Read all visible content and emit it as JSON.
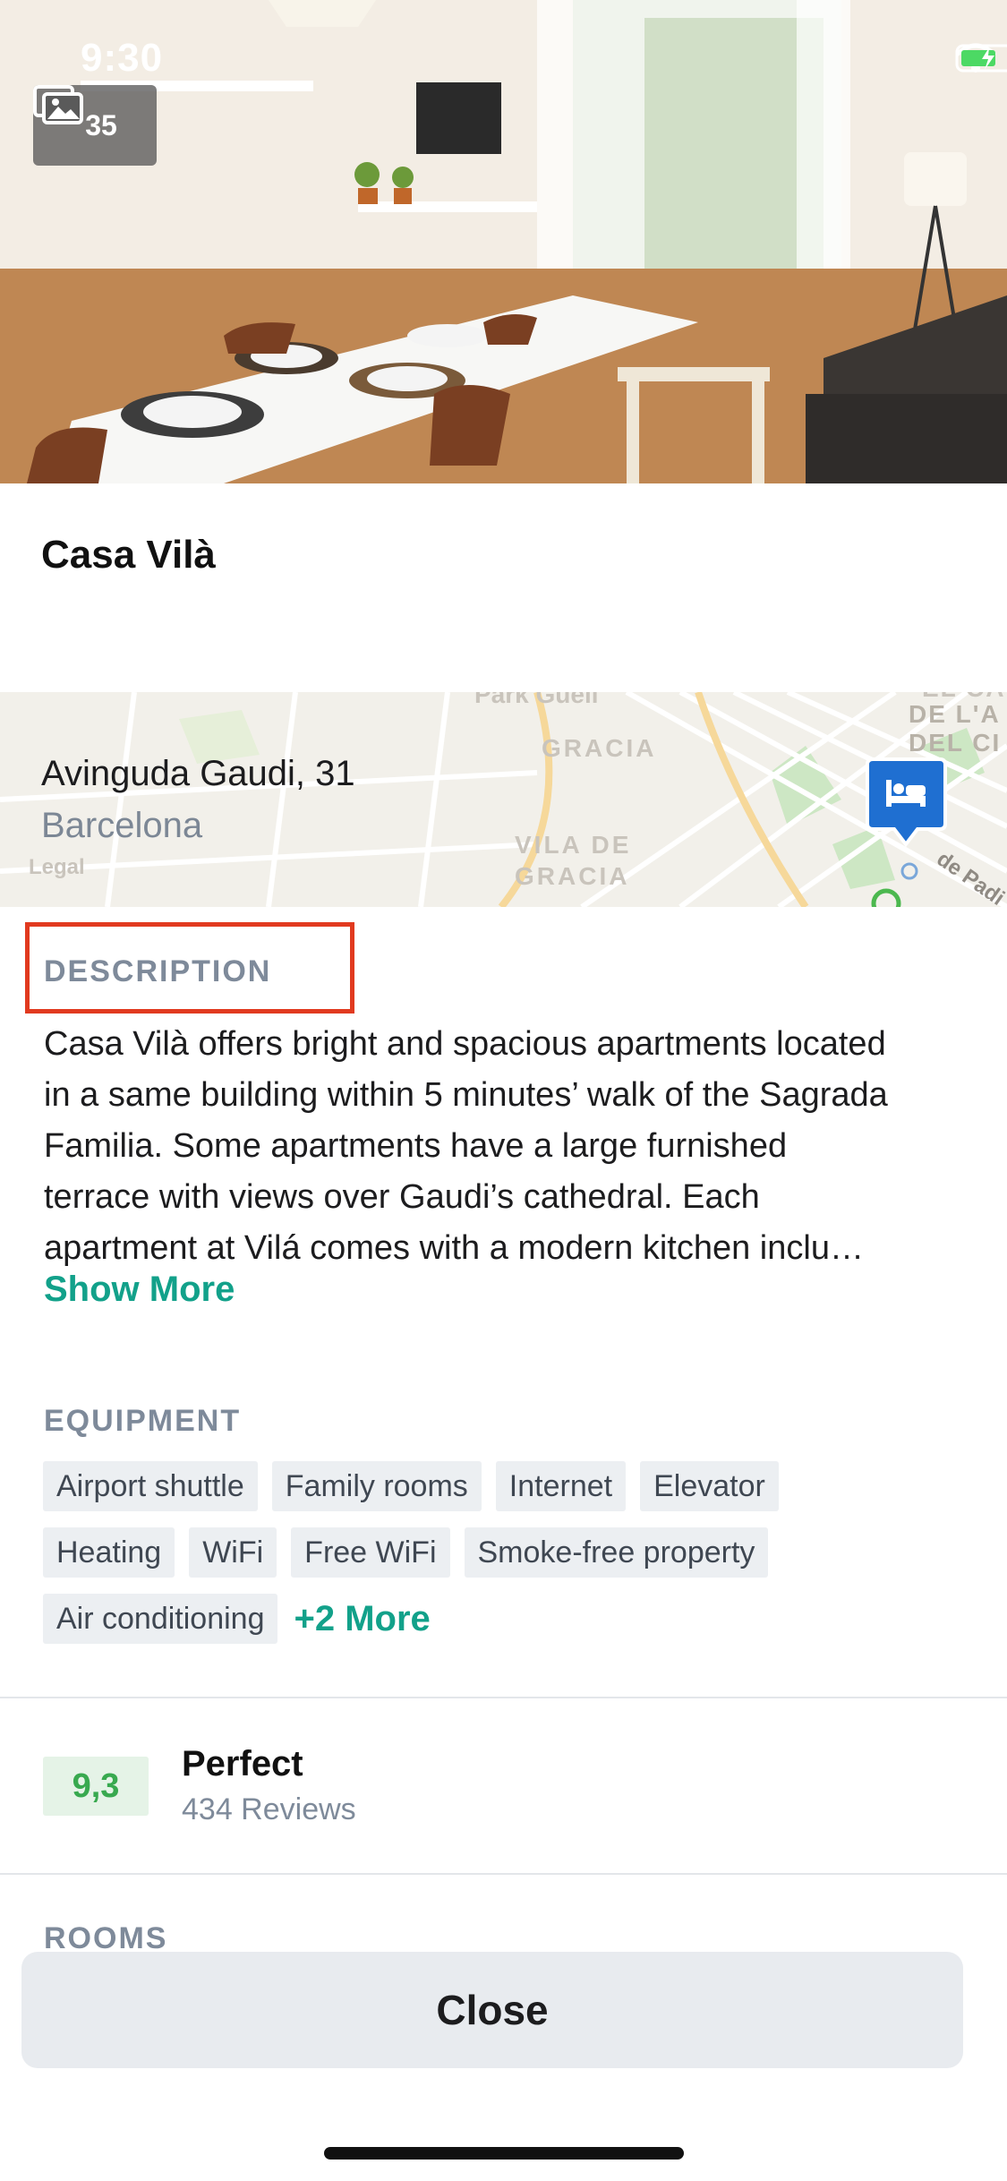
{
  "status_bar": {
    "time": "9:30"
  },
  "gallery": {
    "count": "35"
  },
  "hotel": {
    "name": "Casa Vilà",
    "address_line": "Avinguda Gaudi, 31",
    "city": "Barcelona"
  },
  "map": {
    "labels": [
      "Park Güell",
      "GRACIA",
      "VILA DE",
      "GRACIA",
      "EL CA",
      "DE L'A",
      "DEL CI",
      "de Padi",
      "Legal"
    ]
  },
  "description": {
    "heading": "DESCRIPTION",
    "lines": [
      "Casa Vilà offers bright and spacious apartments located",
      "in a same building within 5 minutes’ walk of the Sagrada",
      "Familia. Some apartments have a large furnished",
      "terrace with views over Gaudi’s cathedral. Each",
      "apartment at Vilá comes with a modern kitchen inclu…"
    ],
    "show_more": "Show More"
  },
  "equipment": {
    "heading": "EQUIPMENT",
    "row1": [
      "Airport shuttle",
      "Family rooms",
      "Internet",
      "Elevator"
    ],
    "row2": [
      "Heating",
      "WiFi",
      "Free WiFi",
      "Smoke-free property"
    ],
    "row3": [
      "Air conditioning"
    ],
    "more": "+2 More"
  },
  "rating": {
    "score": "9,3",
    "label": "Perfect",
    "reviews": "434 Reviews"
  },
  "rooms": {
    "heading": "ROOMS"
  },
  "close_label": "Close",
  "colors": {
    "accent": "#12a18a",
    "highlight": "#e13a1f",
    "score_green": "#38a94f",
    "pin_blue": "#1f6fd1"
  }
}
